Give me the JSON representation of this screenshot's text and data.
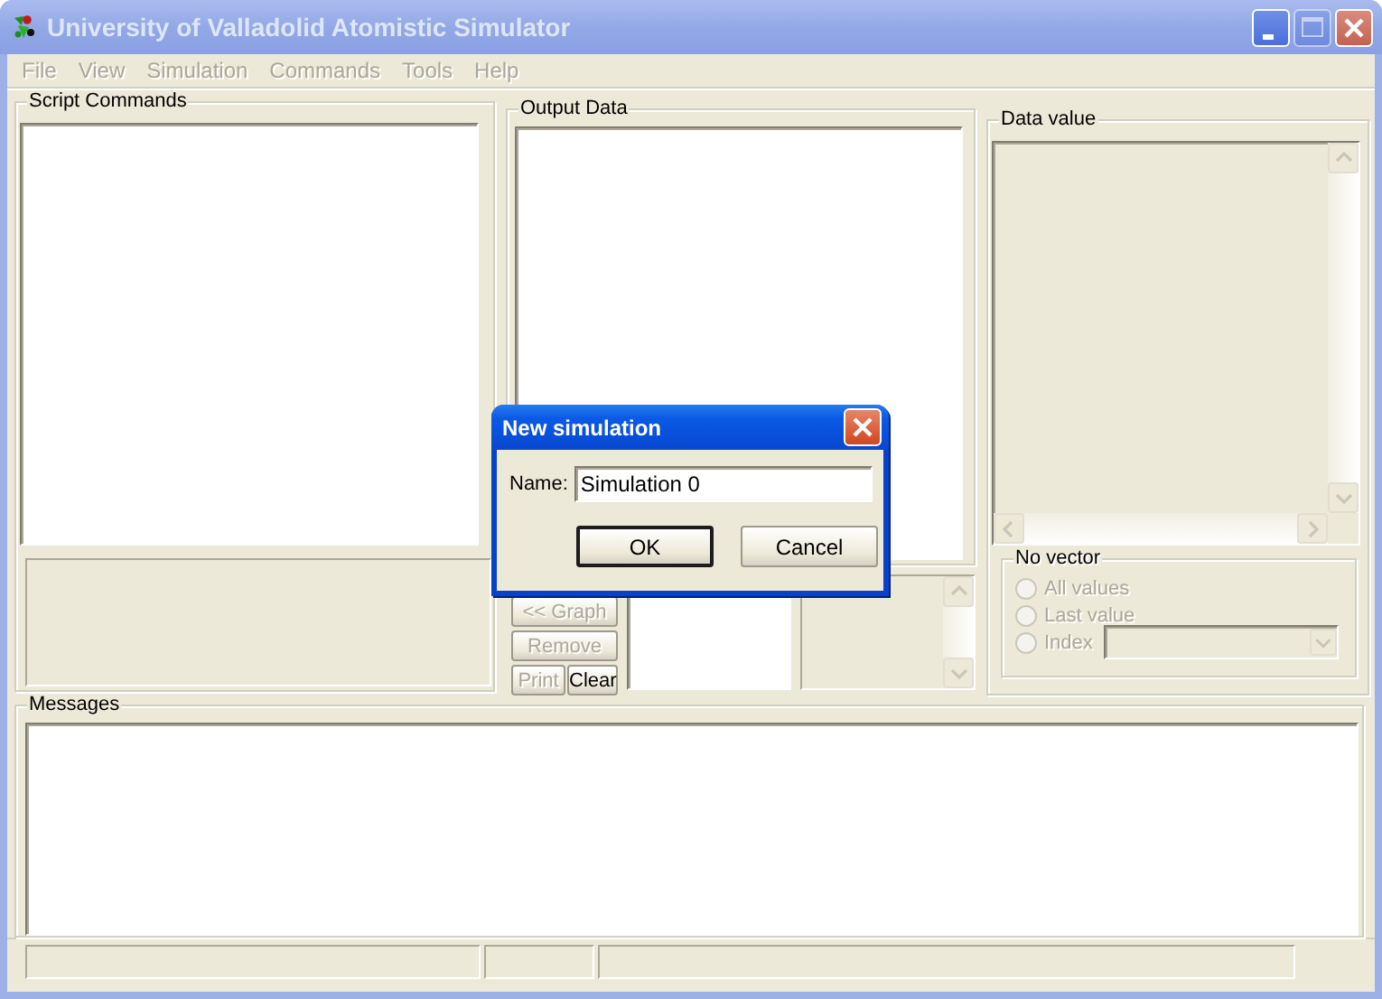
{
  "window": {
    "title": "University of Valladolid Atomistic Simulator",
    "active": false
  },
  "title_buttons": [
    {
      "kind": "minimize",
      "disabled": false
    },
    {
      "kind": "maximize",
      "disabled": true
    },
    {
      "kind": "close",
      "disabled": false
    }
  ],
  "menu": [
    {
      "label": "File",
      "disabled": true
    },
    {
      "label": "View",
      "disabled": true
    },
    {
      "label": "Simulation",
      "disabled": true
    },
    {
      "label": "Commands",
      "disabled": true
    },
    {
      "label": "Tools",
      "disabled": true
    },
    {
      "label": "Help",
      "disabled": true
    }
  ],
  "script_commands": {
    "title": "Script Commands"
  },
  "output_data": {
    "title": "Output Data",
    "buttons": [
      {
        "label": "<< Graph",
        "disabled": true
      },
      {
        "label": "Remove",
        "disabled": true
      },
      {
        "label": "Print",
        "disabled": true
      },
      {
        "label": "Clear",
        "disabled": false
      }
    ]
  },
  "data_value": {
    "title": "Data value",
    "vector_group": {
      "title": "No vector",
      "disabled": true,
      "options": [
        {
          "label": "All values",
          "selected": false
        },
        {
          "label": "Last value",
          "selected": false
        },
        {
          "label": "Index",
          "selected": false
        }
      ]
    }
  },
  "messages": {
    "title": "Messages"
  },
  "dialog": {
    "title": "New simulation",
    "field_label": "Name:",
    "field_value": "Simulation 0",
    "buttons": [
      {
        "label": "OK",
        "default": true
      },
      {
        "label": "Cancel",
        "default": false
      }
    ]
  }
}
